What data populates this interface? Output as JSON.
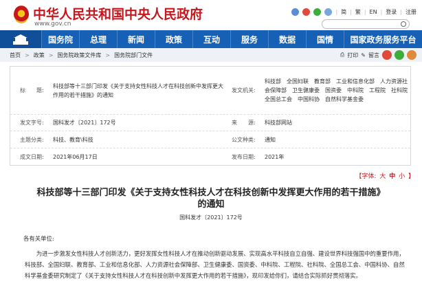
{
  "header": {
    "site_title": "中华人民共和国中央人民政府",
    "domain": "www.gov.cn",
    "util_links": [
      "简",
      "繁",
      "EN",
      "登录",
      "注册"
    ],
    "search_placeholder": ""
  },
  "nav": {
    "items": [
      "国务院",
      "总理",
      "新闻",
      "政策",
      "互动",
      "服务",
      "数据",
      "国情",
      "国家政务服务平台"
    ]
  },
  "breadcrumb": [
    "首页",
    "政策",
    "国务院政策文件库",
    "国务院部门文件"
  ],
  "share": {
    "print": "打印",
    "comment": "留言"
  },
  "meta": {
    "title_label": "标　　题:",
    "title_value": "科技部等十三部门印发《关于支持女性科技人才在科技创新中发挥更大作用的若干措施》的通知",
    "issuer_label": "发文机关:",
    "issuer_value": "科技部　全国妇联　教育部　工业和信息化部　人力资源社会保障部　卫生健康委　国资委　中科院　工程院　社科院　全国总工会　中国科协　自然科学基金委",
    "docno_label": "发文字号:",
    "docno_value": "国科发才〔2021〕172号",
    "source_label": "来　　源:",
    "source_value": "科技部网站",
    "topic_label": "主题分类:",
    "topic_value": "科技、教育\\科技",
    "type_label": "公文种类:",
    "type_value": "通知",
    "written_label": "成文日期:",
    "written_value": "2021年06月17日",
    "publish_label": "发布日期:",
    "publish_value": "2021年"
  },
  "font_size": {
    "label": "【字体:",
    "large": "大",
    "medium": "中",
    "small": "小",
    "end": "】"
  },
  "article": {
    "title_line1": "科技部等十三部门印发《关于支持女性科技人才在科技创新中发挥更大作用的若干措施》",
    "title_line2": "的通知",
    "doc_no": "国科发才〔2021〕172号",
    "salutation": "各有关单位:",
    "paragraph": "为进一步激发女性科技人才创新活力，更好发挥女性科技人才在推动创新驱动发展、实现高水平科技自立自强、建设世界科技强国中的重要作用，科技部、全国妇联、教育部、工业和信息化部、人力资源社会保障部、卫生健康委、国资委、中科院、工程院、社科院、全国总工会、中国科协、自然科学基金委研究制定了《关于支持女性科技人才在科技创新中发挥更大作用的若干措施》，现印发给你们，请结合实际抓好贯彻落实。"
  },
  "colors": {
    "brand_red": "#c8161d",
    "nav_blue": "#1661b5"
  }
}
